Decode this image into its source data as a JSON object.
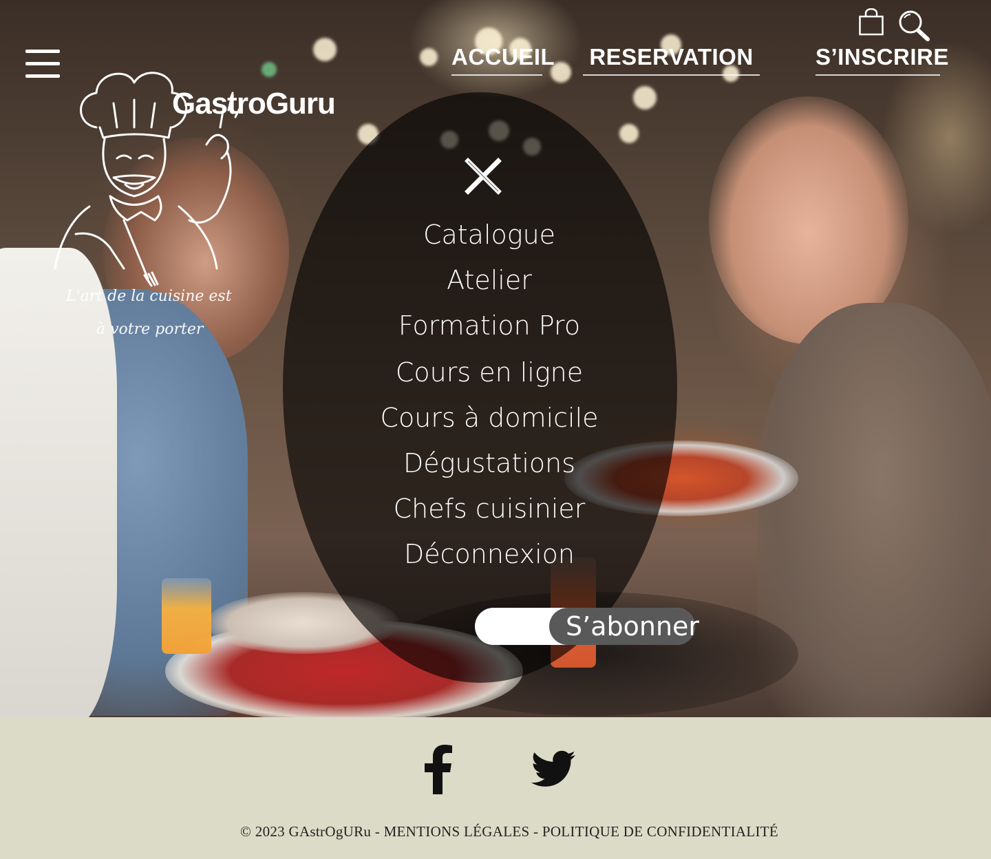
{
  "brand": {
    "name": "GastroGuru",
    "tagline_line1": "L'art de la cuisine est",
    "tagline_line2": "à votre porter",
    "logo_icon": "chef-icon"
  },
  "top_nav": {
    "items": [
      {
        "label": "ACCUEIL"
      },
      {
        "label": "RESERVATION"
      },
      {
        "label": "S’INSCRIRE"
      }
    ],
    "icons": [
      "shopping-bag-icon",
      "search-icon",
      "hamburger-menu-icon"
    ]
  },
  "menu": {
    "close_icon": "close-icon",
    "items": [
      {
        "label": "Catalogue"
      },
      {
        "label": "Atelier"
      },
      {
        "label": "Formation Pro"
      },
      {
        "label": "Cours en ligne"
      },
      {
        "label": "Cours à domicile"
      },
      {
        "label": "Dégustations"
      },
      {
        "label": "Chefs cuisinier"
      },
      {
        "label": "Déconnexion"
      }
    ],
    "subscribe": {
      "input_value": "",
      "button_label": "S’abonner"
    }
  },
  "footer": {
    "social": [
      "facebook-icon",
      "twitter-icon"
    ],
    "text": "© 2023 GAstrOgURu  - MENTIONS LÉGALES - POLITIQUE DE CONFIDENTIALITÉ"
  },
  "colors": {
    "footer_bg": "#dcdbc8",
    "overlay": "rgba(0,0,0,0.62)",
    "text_light": "#ffffff"
  }
}
